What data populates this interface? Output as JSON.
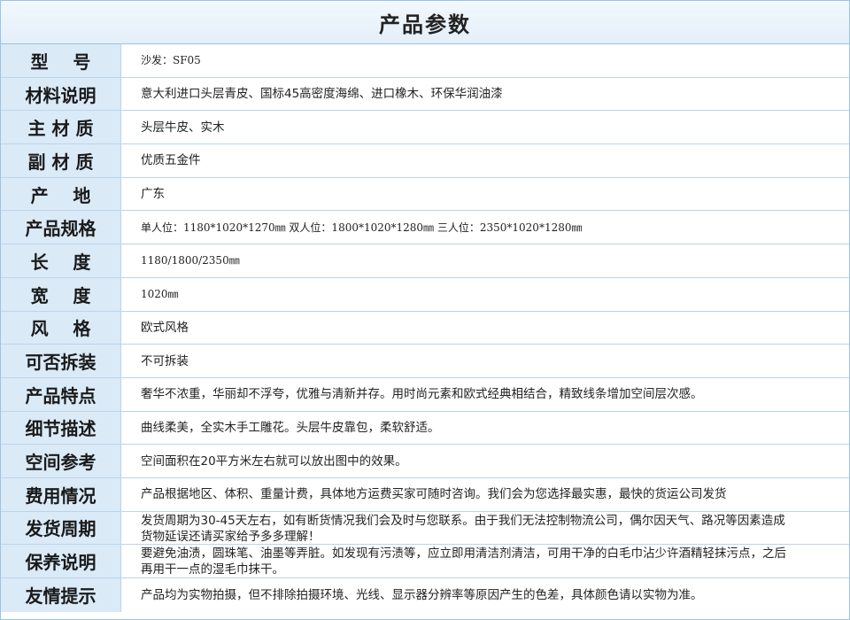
{
  "title": "产品参数",
  "rows": [
    {
      "label": "型    号",
      "value": "沙发：SF05",
      "name": "row-model"
    },
    {
      "label": "材料说明",
      "value": "意大利进口头层青皮、国标45高密度海绵、进口橡木、环保华润油漆",
      "name": "row-material-desc"
    },
    {
      "label": "主 材 质",
      "value": "头层牛皮、实木",
      "name": "row-main-material"
    },
    {
      "label": "副 材 质",
      "value": "优质五金件",
      "name": "row-sub-material"
    },
    {
      "label": "产    地",
      "value": "广东",
      "name": "row-origin"
    },
    {
      "label": "产品规格",
      "value": "单人位：1180*1020*1270㎜  双人位：1800*1020*1280㎜  三人位：2350*1020*1280㎜",
      "name": "row-spec"
    },
    {
      "label": "长    度",
      "value": "1180/1800/2350㎜",
      "name": "row-length"
    },
    {
      "label": "宽    度",
      "value": "1020㎜",
      "name": "row-width"
    },
    {
      "label": "风    格",
      "value": "欧式风格",
      "name": "row-style"
    },
    {
      "label": "可否拆装",
      "value": "不可拆装",
      "name": "row-detachable"
    },
    {
      "label": "产品特点",
      "value": "奢华不浓重，华丽却不浮夸，优雅与清新并存。用时尚元素和欧式经典相结合，精致线条增加空间层次感。",
      "name": "row-features"
    },
    {
      "label": "细节描述",
      "value": "曲线柔美，全实木手工雕花。头层牛皮靠包，柔软舒适。",
      "name": "row-details"
    },
    {
      "label": "空间参考",
      "value": "空间面积在20平方米左右就可以放出图中的效果。",
      "name": "row-space"
    },
    {
      "label": "费用情况",
      "value": "产品根据地区、体积、重量计费，具体地方运费买家可随时咨询。我们会为您选择最实惠，最快的货运公司发货",
      "name": "row-cost"
    },
    {
      "label": "发货周期",
      "value": "发货周期为30-45天左右，如有断货情况我们会及时与您联系。由于我们无法控制物流公司，偶尔因天气、路况等因素造成货物延误还请买家给予多多理解！",
      "name": "row-shipping"
    },
    {
      "label": "保养说明",
      "value": "要避免油渍，圆珠笔、油墨等弄脏。如发现有污渍等，应立即用清洁剂清洁，可用干净的白毛巾沾少许酒精轻抹污点，之后再用干一点的湿毛巾抹干。",
      "name": "row-maintenance"
    },
    {
      "label": "友情提示",
      "value": "产品均为实物拍摄，但不排除拍摄环境、光线、显示器分辨率等原因产生的色差，具体颜色请以实物为准。",
      "name": "row-tips"
    }
  ]
}
